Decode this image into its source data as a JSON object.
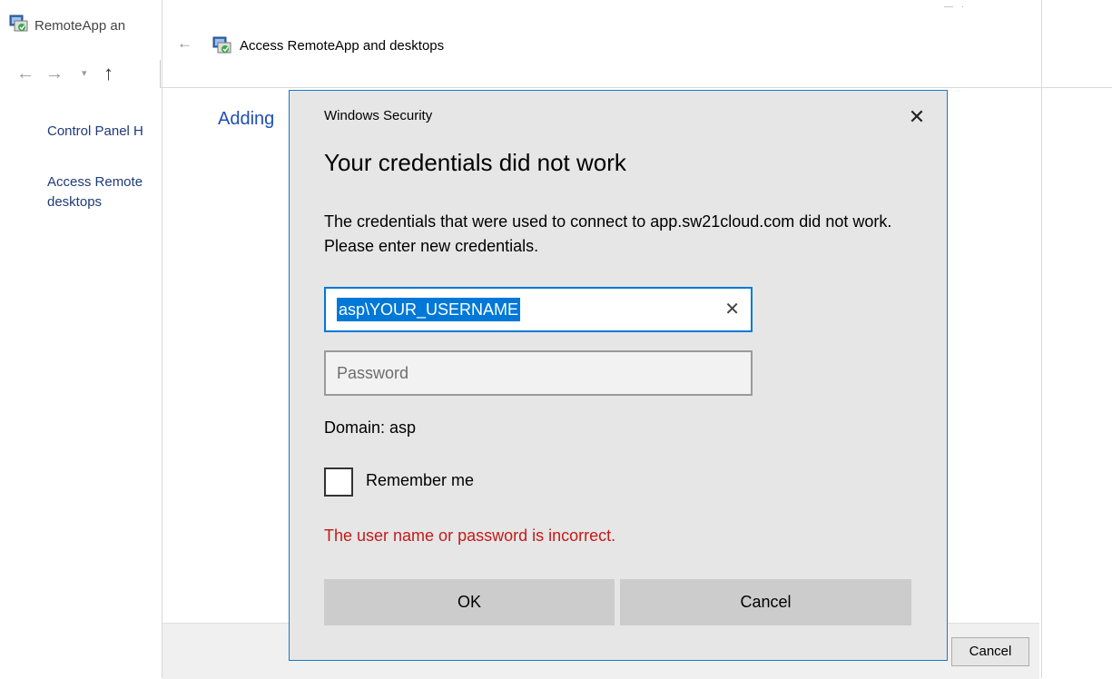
{
  "background_window": {
    "title": "RemoteApp an",
    "sidebar": {
      "home_link": "Control Panel H",
      "access_link": "Access Remote desktops"
    },
    "wizard": {
      "title": "Access RemoteApp and desktops",
      "heading": "Adding",
      "cancel_label": "Cancel"
    },
    "nav_icons": [
      "back-arrow-icon",
      "forward-arrow-icon",
      "recent-chevron-icon",
      "up-arrow-icon"
    ]
  },
  "dialog": {
    "caption": "Windows Security",
    "heading": "Your credentials did not work",
    "message": "The credentials that were used to connect to app.sw21cloud.com did not work. Please enter new credentials.",
    "username_value": "asp\\YOUR_USERNAME",
    "password_placeholder": "Password",
    "domain_text": "Domain: asp",
    "remember_label": "Remember me",
    "remember_checked": false,
    "error_text": "The user name or password is incorrect.",
    "ok_label": "OK",
    "cancel_label": "Cancel",
    "accent_color": "#0078d7",
    "error_color": "#c41a1a"
  }
}
